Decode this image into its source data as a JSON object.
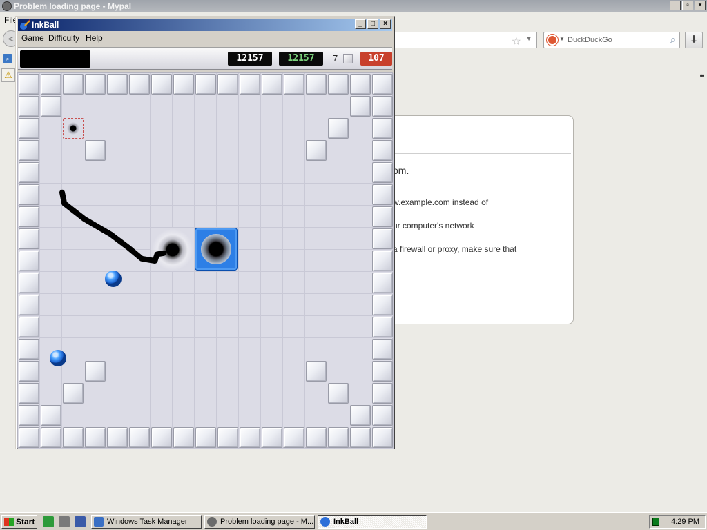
{
  "browser": {
    "title": "Problem loading page - Mypal",
    "menu_file": "File",
    "back_label": "<",
    "search_placeholder": "DuckDuckGo",
    "error_fragments": [
      "om.",
      "w.example.com instead of",
      "ur computer's network",
      "a firewall or proxy, make sure that"
    ]
  },
  "inkball": {
    "title": "InkBall",
    "menus": [
      "Game",
      "Difficulty",
      "Help"
    ],
    "score": "12157",
    "high_score": "12157",
    "balls_remaining": "7",
    "timer": "107",
    "board": {
      "cols": 17,
      "rows": 17,
      "walls": [
        [
          0,
          0
        ],
        [
          1,
          0
        ],
        [
          2,
          0
        ],
        [
          3,
          0
        ],
        [
          4,
          0
        ],
        [
          5,
          0
        ],
        [
          6,
          0
        ],
        [
          7,
          0
        ],
        [
          8,
          0
        ],
        [
          9,
          0
        ],
        [
          10,
          0
        ],
        [
          11,
          0
        ],
        [
          12,
          0
        ],
        [
          13,
          0
        ],
        [
          14,
          0
        ],
        [
          15,
          0
        ],
        [
          16,
          0
        ],
        [
          0,
          16
        ],
        [
          1,
          16
        ],
        [
          2,
          16
        ],
        [
          3,
          16
        ],
        [
          4,
          16
        ],
        [
          5,
          16
        ],
        [
          6,
          16
        ],
        [
          7,
          16
        ],
        [
          8,
          16
        ],
        [
          9,
          16
        ],
        [
          10,
          16
        ],
        [
          11,
          16
        ],
        [
          12,
          16
        ],
        [
          13,
          16
        ],
        [
          14,
          16
        ],
        [
          15,
          16
        ],
        [
          16,
          16
        ],
        [
          0,
          1
        ],
        [
          0,
          2
        ],
        [
          0,
          3
        ],
        [
          0,
          4
        ],
        [
          0,
          5
        ],
        [
          0,
          6
        ],
        [
          0,
          7
        ],
        [
          0,
          8
        ],
        [
          0,
          9
        ],
        [
          0,
          10
        ],
        [
          0,
          11
        ],
        [
          0,
          12
        ],
        [
          0,
          13
        ],
        [
          0,
          14
        ],
        [
          0,
          15
        ],
        [
          16,
          1
        ],
        [
          16,
          2
        ],
        [
          16,
          3
        ],
        [
          16,
          4
        ],
        [
          16,
          5
        ],
        [
          16,
          6
        ],
        [
          16,
          7
        ],
        [
          16,
          8
        ],
        [
          16,
          9
        ],
        [
          16,
          10
        ],
        [
          16,
          11
        ],
        [
          16,
          12
        ],
        [
          16,
          13
        ],
        [
          16,
          14
        ],
        [
          16,
          15
        ],
        [
          1,
          1
        ],
        [
          3,
          3
        ],
        [
          15,
          1
        ],
        [
          14,
          2
        ],
        [
          13,
          3
        ],
        [
          1,
          15
        ],
        [
          2,
          14
        ],
        [
          3,
          13
        ],
        [
          15,
          15
        ],
        [
          14,
          14
        ],
        [
          13,
          13
        ]
      ],
      "spawn": [
        2,
        2
      ],
      "hole_grey": [
        6,
        7
      ],
      "hole_blue": [
        8,
        7
      ],
      "balls": [
        [
          4.3,
          9.3
        ],
        [
          1.8,
          12.9
        ]
      ],
      "ink_path": [
        [
          2,
          5.4
        ],
        [
          2.1,
          5.9
        ],
        [
          3,
          6.6
        ],
        [
          4.2,
          7.3
        ],
        [
          5,
          7.9
        ],
        [
          5.6,
          8.4
        ],
        [
          6.2,
          8.5
        ],
        [
          6.3,
          8.2
        ],
        [
          6.6,
          8.15
        ]
      ]
    }
  },
  "taskbar": {
    "start_label": "Start",
    "tasks": [
      {
        "label": "Windows Task Manager"
      },
      {
        "label": "Problem loading page - M..."
      },
      {
        "label": "InkBall"
      }
    ],
    "clock": "4:29 PM"
  },
  "colors": {
    "inkball_titlebar": "#0a246a",
    "ball_blue": "#1a60cc",
    "hole_blue": "#2d7fe6",
    "timer_red": "#c8402c",
    "ink": "#000000"
  }
}
